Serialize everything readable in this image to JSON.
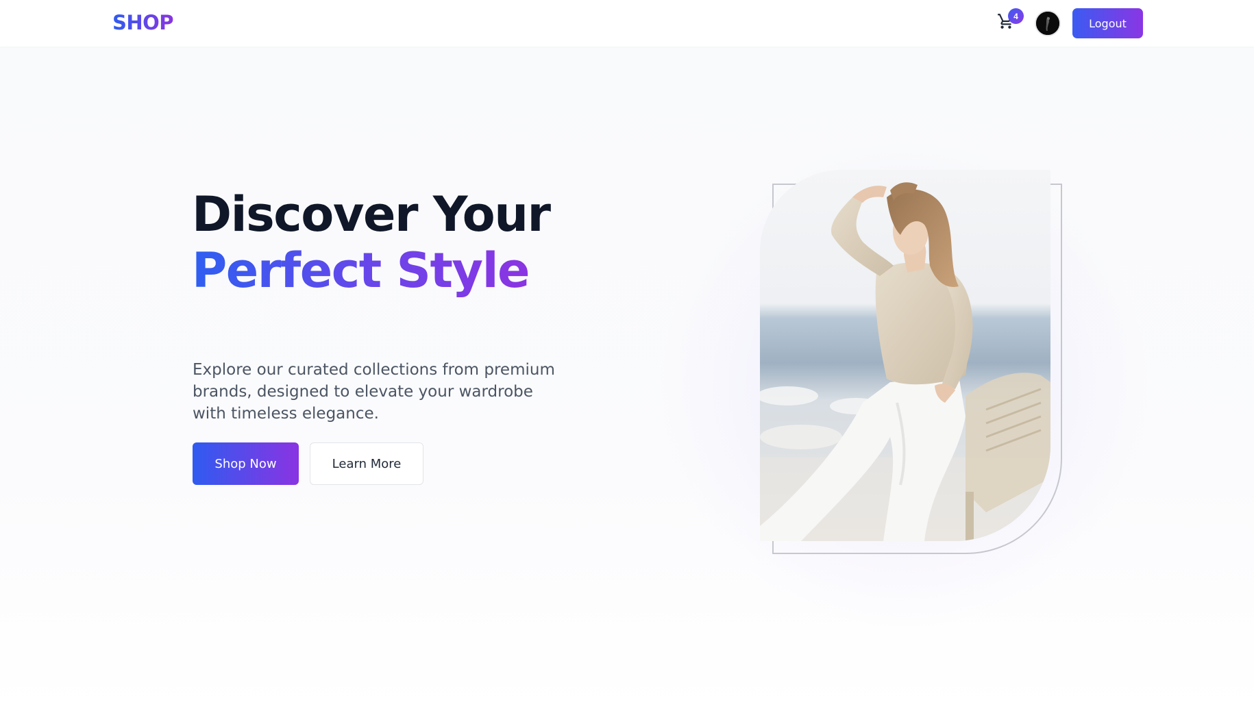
{
  "nav": {
    "logo": "SHOP",
    "cart_count": "4",
    "logout_label": "Logout",
    "icons": [
      "cart-icon",
      "avatar"
    ]
  },
  "hero": {
    "headline_line1": "Discover Your",
    "headline_line2": "Perfect Style",
    "subtitle": "Explore our curated collections from premium brands, designed to elevate your wardrobe with timeless elegance.",
    "primary_cta": "Shop Now",
    "secondary_cta": "Learn More"
  },
  "colors": {
    "accent_start": "#2f5bf0",
    "accent_end": "#8a34e2",
    "headline_dark": "#0f1728",
    "body_text": "#4b5563"
  }
}
